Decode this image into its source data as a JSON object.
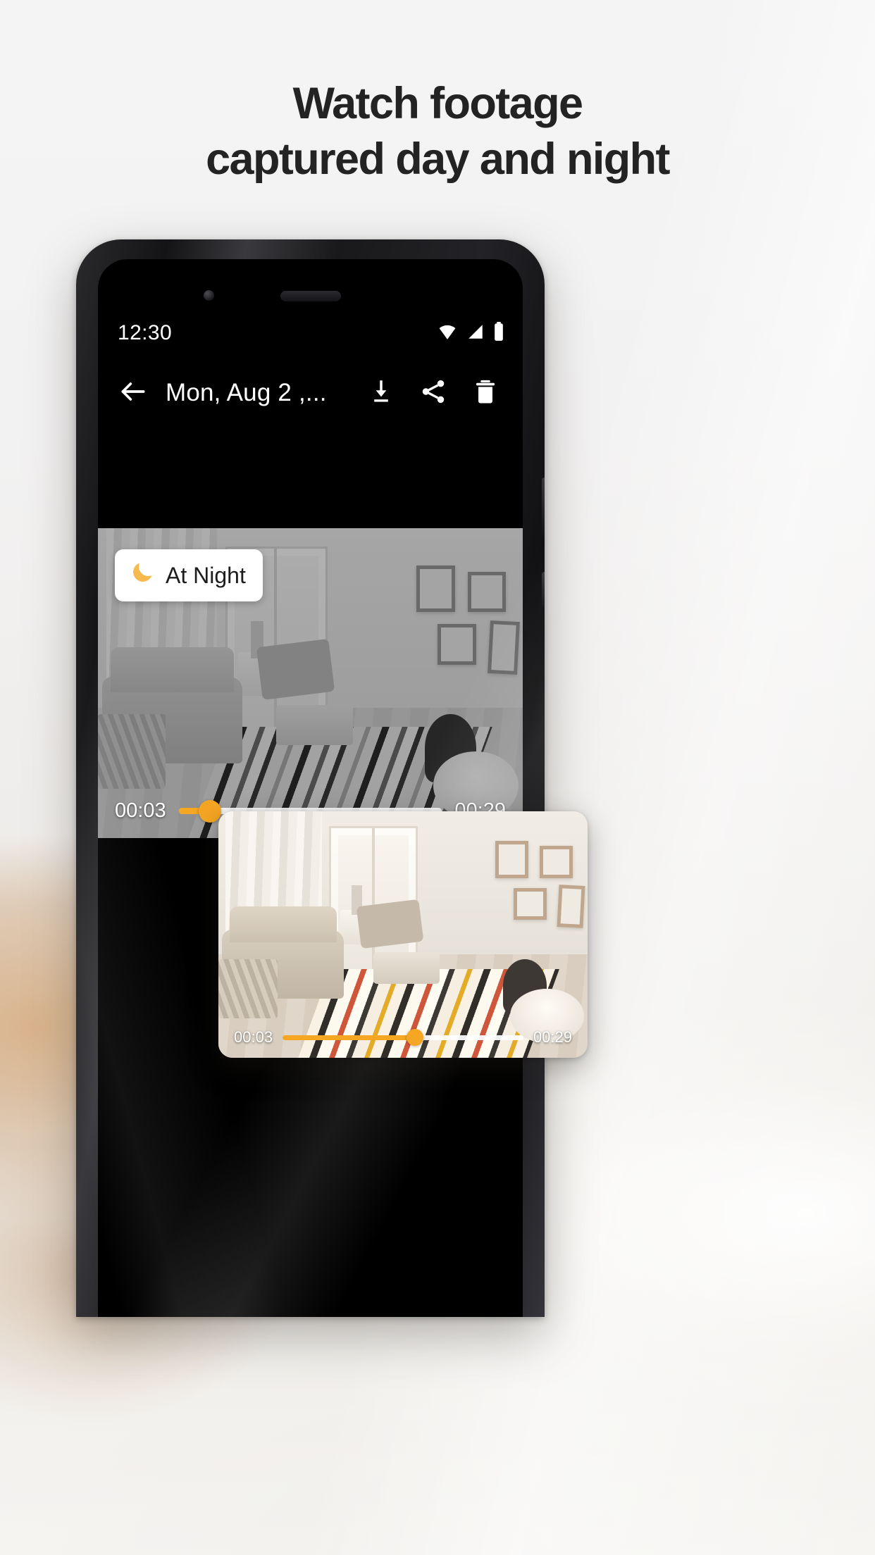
{
  "headline": {
    "line1": "Watch footage",
    "line2": "captured day and night"
  },
  "phone": {
    "statusbar": {
      "time": "12:30",
      "icons": [
        "wifi-icon",
        "cellular-signal-icon",
        "battery-icon"
      ]
    },
    "toolbar": {
      "back_icon": "back-arrow-icon",
      "title": "Mon, Aug 2 ,...",
      "actions": [
        {
          "name": "download-button",
          "icon": "download-icon"
        },
        {
          "name": "share-button",
          "icon": "share-icon"
        },
        {
          "name": "delete-button",
          "icon": "trash-icon"
        }
      ]
    },
    "player_night": {
      "badge": {
        "icon": "moon-icon",
        "label": "At Night"
      },
      "current_time": "00:03",
      "total_time": "00:29",
      "progress_percent": 12,
      "accent_color": "#F5A623",
      "track_color": "#FFFFFF"
    },
    "player_day": {
      "current_time": "00:03",
      "total_time": "00:29",
      "progress_percent": 55,
      "accent_color": "#F5A623",
      "track_color": "#FFFFFF"
    }
  },
  "theme": {
    "headline_color": "#232323",
    "page_background": "#F2F2F3",
    "toolbar_background": "#000000",
    "chip_background": "#FFFFFF",
    "moon_color": "#F5B94E"
  }
}
